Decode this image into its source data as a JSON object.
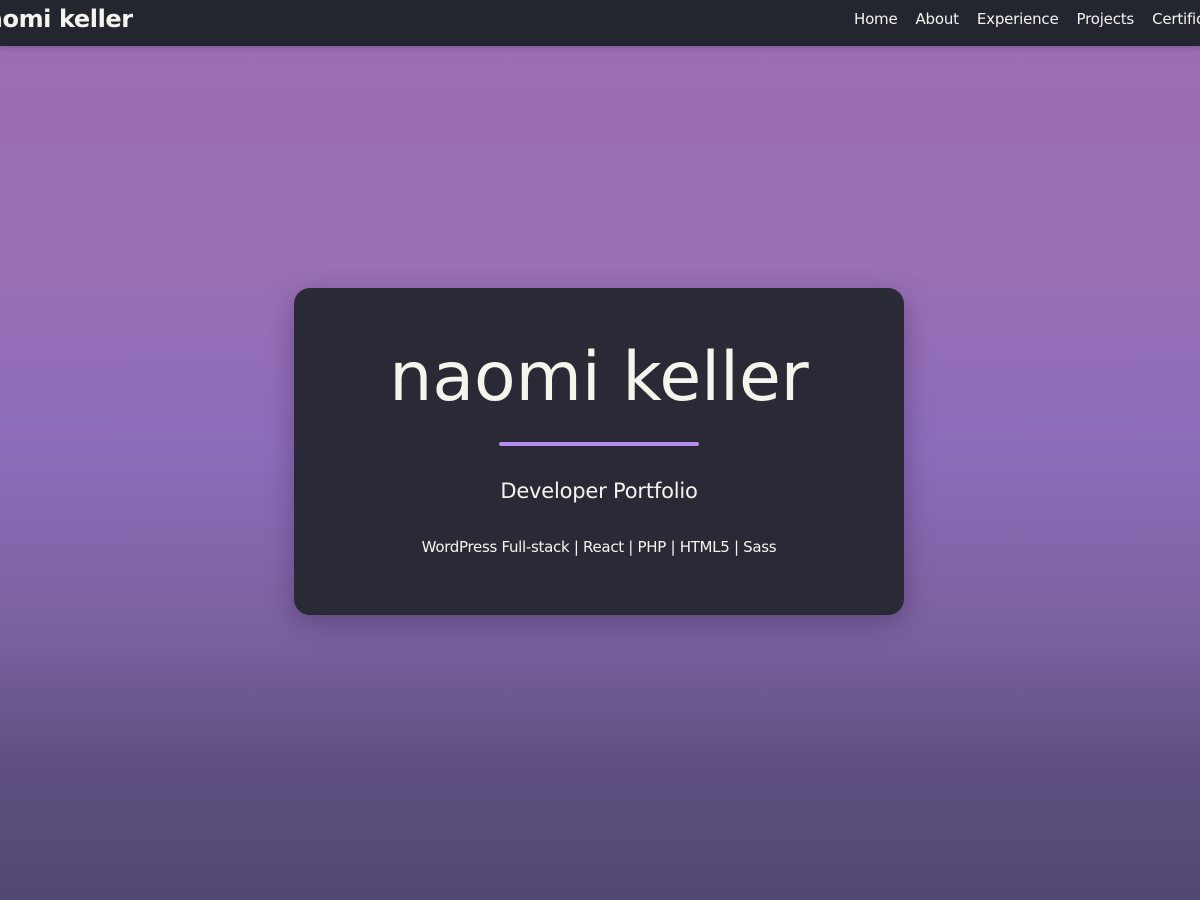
{
  "navbar": {
    "brand": "naomi keller",
    "links": [
      {
        "label": "Home"
      },
      {
        "label": "About"
      },
      {
        "label": "Experience"
      },
      {
        "label": "Projects"
      },
      {
        "label": "Certific"
      }
    ]
  },
  "hero": {
    "title": "naomi keller",
    "subtitle": "Developer Portfolio",
    "tags": "WordPress Full-stack | React | PHP | HTML5 | Sass"
  },
  "colors": {
    "navbar_bg": "#23252f",
    "card_bg": "#292a36",
    "accent": "#b58cf0",
    "text": "#f4f4ef"
  }
}
